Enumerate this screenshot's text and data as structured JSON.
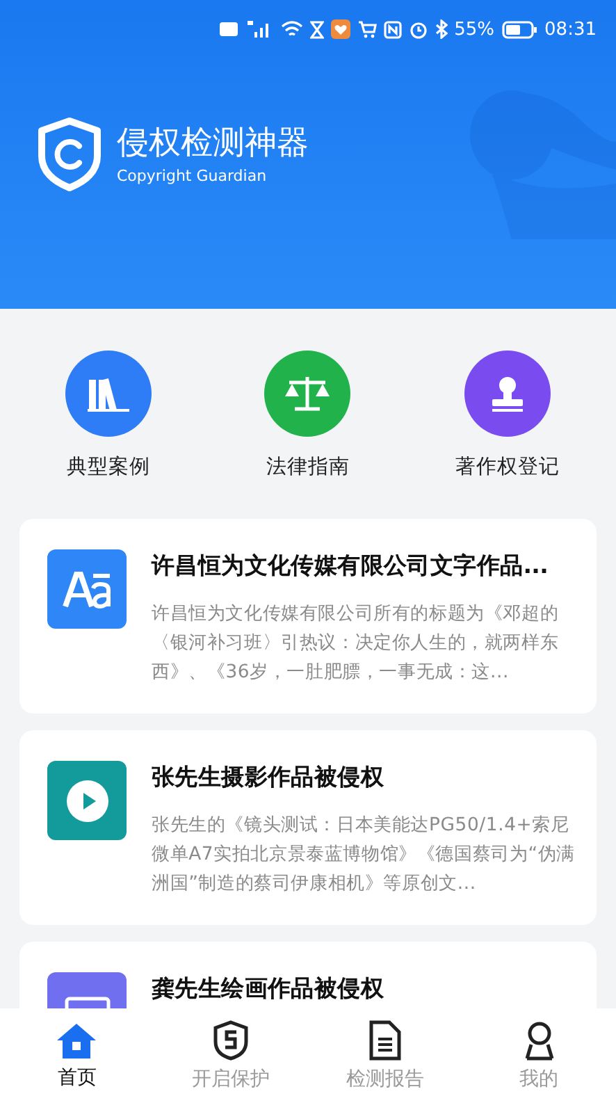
{
  "status_bar": {
    "battery": "55%",
    "time": "08:31"
  },
  "header": {
    "title": "侵权检测神器",
    "subtitle": "Copyright Guardian"
  },
  "shortcuts": [
    {
      "kind": "books",
      "label": "典型案例",
      "color": "#2f7df6"
    },
    {
      "kind": "scale",
      "label": "法律指南",
      "color": "#22b24c"
    },
    {
      "kind": "stamp",
      "label": "著作权登记",
      "color": "#7a4cf0"
    }
  ],
  "cases": [
    {
      "kind": "text",
      "title": "许昌恒为文化传媒有限公司文字作品...",
      "description": "许昌恒为文化传媒有限公司所有的标题为《邓超的〈银河补习班〉引热议：决定你人生的，就两样东西》、《36岁，一肚肥膘，一事无成：这..."
    },
    {
      "kind": "video",
      "title": "张先生摄影作品被侵权",
      "description": "张先生的《镜头测试：日本美能达PG50/1.4+索尼微单A7实拍北京景泰蓝博物馆》《德国蔡司为“伪满洲国”制造的蔡司伊康相机》等原创文..."
    },
    {
      "kind": "image",
      "title": "龚先生绘画作品被侵权"
    }
  ],
  "nav": [
    {
      "kind": "home",
      "label": "首页",
      "selected": true
    },
    {
      "kind": "shield",
      "label": "开启保护",
      "selected": false
    },
    {
      "kind": "report",
      "label": "检测报告",
      "selected": false
    },
    {
      "kind": "user",
      "label": "我的",
      "selected": false
    }
  ]
}
